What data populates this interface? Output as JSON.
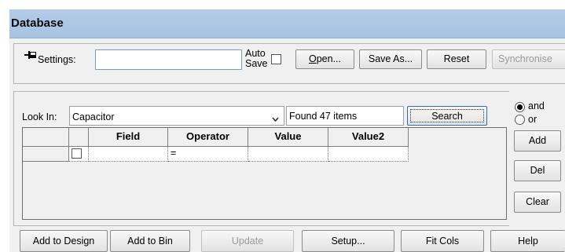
{
  "panel": {
    "title": "Database"
  },
  "settings": {
    "label": "Settings:",
    "value": "",
    "auto_save_label_1": "Auto",
    "auto_save_label_2": "Save",
    "open_label": "Open...",
    "save_as_label": "Save As...",
    "reset_label": "Reset",
    "synchronise_label": "Synchronise"
  },
  "search": {
    "look_in_label": "Look In:",
    "look_in_value": "Capacitor",
    "found_text": "Found 47 items",
    "search_label": "Search",
    "and_label": "and",
    "or_label": "or",
    "add_label": "Add",
    "del_label": "Del",
    "clear_label": "Clear"
  },
  "grid": {
    "columns": [
      "Field",
      "Operator",
      "Value",
      "Value2"
    ],
    "rows": [
      {
        "field": "",
        "operator": "=",
        "value": "",
        "value2": ""
      }
    ]
  },
  "footer": {
    "add_to_design": "Add to Design",
    "add_to_bin": "Add to Bin",
    "update": "Update",
    "setup": "Setup...",
    "fit_cols": "Fit Cols",
    "help": "Help"
  }
}
